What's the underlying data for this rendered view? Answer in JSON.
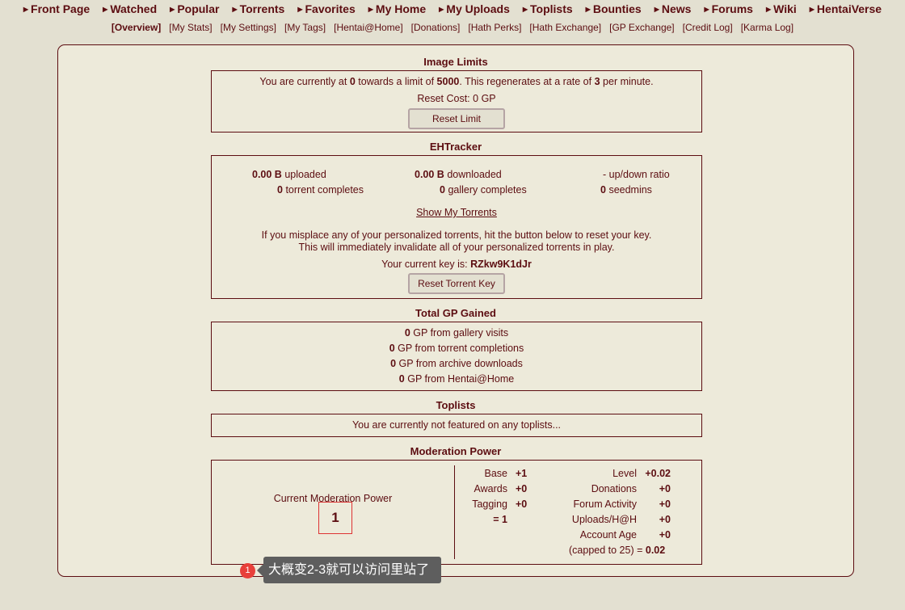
{
  "topnav": [
    "Front Page",
    "Watched",
    "Popular",
    "Torrents",
    "Favorites",
    "My Home",
    "My Uploads",
    "Toplists",
    "Bounties",
    "News",
    "Forums",
    "Wiki",
    "HentaiVerse"
  ],
  "subnav": [
    "[Overview]",
    "[My Stats]",
    "[My Settings]",
    "[My Tags]",
    "[Hentai@Home]",
    "[Donations]",
    "[Hath Perks]",
    "[Hath Exchange]",
    "[GP Exchange]",
    "[Credit Log]",
    "[Karma Log]"
  ],
  "image_limits": {
    "title": "Image Limits",
    "line_prefix": "You are currently at",
    "current": "0",
    "line_mid": "towards a limit of",
    "limit": "5000",
    "line_mid2": ". This regenerates at a rate of",
    "rate": "3",
    "line_suffix": "per minute.",
    "reset_cost_label": "Reset Cost:",
    "reset_cost": "0 GP",
    "reset_button": "Reset Limit"
  },
  "ehtracker": {
    "title": "EHTracker",
    "uploaded_value": "0.00 B",
    "uploaded_label": "uploaded",
    "downloaded_value": "0.00 B",
    "downloaded_label": "downloaded",
    "ratio_value": "-",
    "ratio_label": "up/down ratio",
    "torrent_completes_value": "0",
    "torrent_completes_label": "torrent completes",
    "gallery_completes_value": "0",
    "gallery_completes_label": "gallery completes",
    "seedmins_value": "0",
    "seedmins_label": "seedmins",
    "show_torrents_link": "Show My Torrents",
    "misplace_line1": "If you misplace any of your personalized torrents, hit the button below to reset your key.",
    "misplace_line2": "This will immediately invalidate all of your personalized torrents in play.",
    "key_label": "Your current key is:",
    "key_value": "RZkw9K1dJr",
    "reset_key_button": "Reset Torrent Key"
  },
  "gp_gained": {
    "title": "Total GP Gained",
    "rows": [
      {
        "value": "0",
        "label": "GP from gallery visits"
      },
      {
        "value": "0",
        "label": "GP from torrent completions"
      },
      {
        "value": "0",
        "label": "GP from archive downloads"
      },
      {
        "value": "0",
        "label": "GP from Hentai@Home"
      }
    ]
  },
  "toplists": {
    "title": "Toplists",
    "message": "You are currently not featured on any toplists..."
  },
  "moderation": {
    "title": "Moderation Power",
    "current_label": "Current Moderation Power",
    "current_value": "1",
    "left_rows": [
      {
        "label": "Base",
        "value": "+1"
      },
      {
        "label": "Awards",
        "value": "+0"
      },
      {
        "label": "Tagging",
        "value": "+0"
      },
      {
        "label": "= 1",
        "value": ""
      }
    ],
    "right_rows": [
      {
        "label": "Level",
        "value": "+0.02"
      },
      {
        "label": "Donations",
        "value": "+0"
      },
      {
        "label": "Forum Activity",
        "value": "+0"
      },
      {
        "label": "Uploads/H@H",
        "value": "+0"
      },
      {
        "label": "Account Age",
        "value": "+0"
      }
    ],
    "capped_label": "(capped to 25) =",
    "capped_value": "0.02"
  },
  "tooltip": {
    "badge": "1",
    "text": "大概变2-3就可以访问里站了"
  }
}
